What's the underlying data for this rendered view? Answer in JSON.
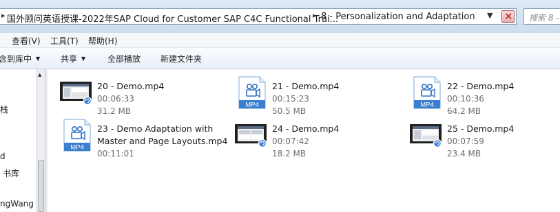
{
  "address": {
    "crumbs": [
      "国外顾问英语授课-2022年SAP Cloud for Customer SAP C4C Functional Trai...",
      "8 - Personalization and Adaptation"
    ],
    "search_placeholder": "搜索 8 -"
  },
  "menu": [
    "查看(V)",
    "工具(T)",
    "帮助(H)"
  ],
  "commands": {
    "library": "包含到库中",
    "share": "共享",
    "play_all": "全部播放",
    "new_folder": "新建文件夹"
  },
  "nav": [
    "栈",
    "d",
    "书库",
    "ngWang"
  ],
  "files": [
    {
      "name": "20 - Demo.mp4",
      "duration": "00:06:33",
      "size": "31.2 MB",
      "icon": "video-thumbnail-icon"
    },
    {
      "name": "21 - Demo.mp4",
      "duration": "00:15:23",
      "size": "50.5 MB",
      "icon": "mp4-file-icon",
      "badge": "MP4"
    },
    {
      "name": "22 - Demo.mp4",
      "duration": "00:10:36",
      "size": "64.2 MB",
      "icon": "mp4-file-icon",
      "badge": "MP4"
    },
    {
      "name": "23 - Demo Adaptation with",
      "name_line2": "Master and Page Layouts.mp4",
      "duration": "00:11:01",
      "icon": "mp4-file-icon",
      "badge": "MP4"
    },
    {
      "name": "24 - Demo.mp4",
      "duration": "00:07:42",
      "size": "18.2 MB",
      "icon": "video-thumbnail-icon"
    },
    {
      "name": "25 - Demo.mp4",
      "duration": "00:07:59",
      "size": "23.4 MB",
      "icon": "video-thumbnail-icon"
    }
  ]
}
